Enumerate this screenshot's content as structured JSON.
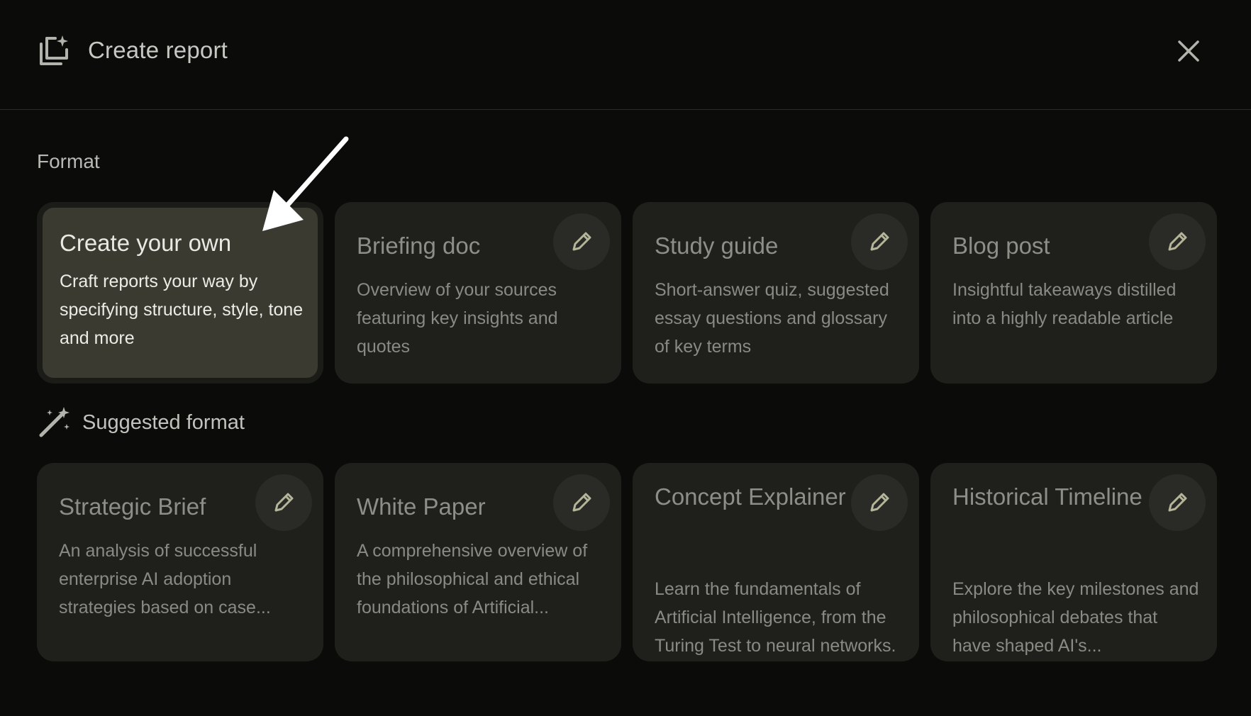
{
  "header": {
    "title": "Create report",
    "icon": "report-sparkle-icon",
    "close_icon": "close-icon"
  },
  "format": {
    "label": "Format",
    "cards": [
      {
        "title": "Create your own",
        "description": "Craft reports your way by specifying structure, style, tone and more",
        "selected": true
      },
      {
        "title": "Briefing doc",
        "description": "Overview of your sources featuring key insights and quotes",
        "icon": "pencil-icon"
      },
      {
        "title": "Study guide",
        "description": "Short-answer quiz, suggested essay questions and glossary of key terms",
        "icon": "pencil-icon"
      },
      {
        "title": "Blog post",
        "description": "Insightful takeaways distilled into a highly readable article",
        "icon": "pencil-icon"
      }
    ]
  },
  "suggested": {
    "label": "Suggested format",
    "icon": "magic-wand-icon",
    "cards": [
      {
        "title": "Strategic Brief",
        "description": "An analysis of successful enterprise AI adoption strategies based on case...",
        "icon": "pencil-icon"
      },
      {
        "title": "White Paper",
        "description": "A comprehensive overview of the philosophical and ethical foundations of Artificial...",
        "icon": "pencil-icon"
      },
      {
        "title": "Concept Explainer",
        "description": "Learn the fundamentals of Artificial Intelligence, from the Turing Test to neural networks.",
        "icon": "pencil-icon"
      },
      {
        "title": "Historical Timeline",
        "description": "Explore the key milestones and philosophical debates that have shaped AI's...",
        "icon": "pencil-icon"
      }
    ]
  },
  "colors": {
    "background": "#0b0b0a",
    "card": "#1f1f1c",
    "card_selected": "#3a3a31",
    "edit_button": "#2a2a26"
  }
}
